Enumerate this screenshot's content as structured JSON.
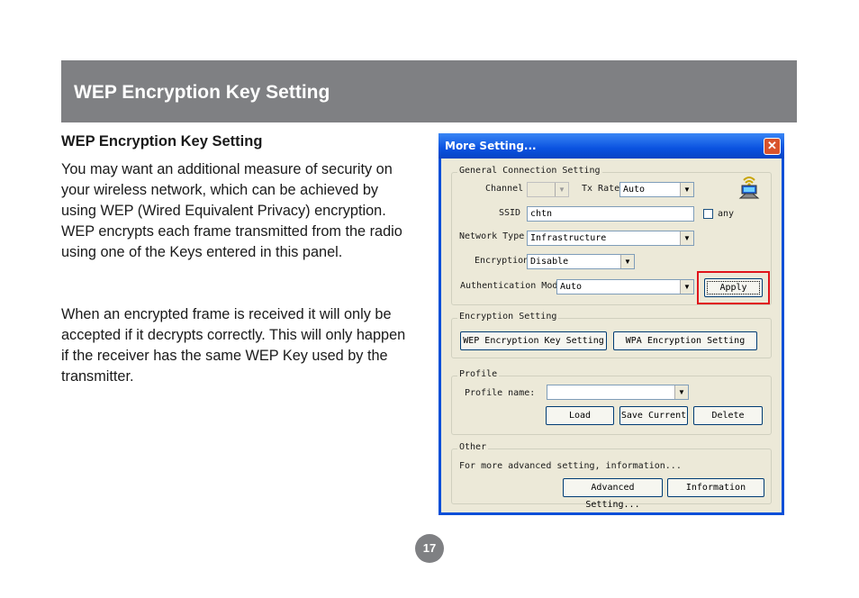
{
  "banner": {
    "title": "WEP Encryption Key Setting"
  },
  "section": {
    "title": "WEP Encryption Key Setting",
    "paragraph1": "You may want an additional measure of security on your wireless network, which can be achieved by using WEP (Wired Equivalent Privacy) encryption. WEP encrypts each frame transmitted from the radio using one of the Keys entered in this panel.",
    "paragraph2": "When an encrypted frame is received it will only be accepted if it decrypts correctly. This will only happen if the receiver has the same WEP Key used by the transmitter."
  },
  "page_number": "17",
  "dialog": {
    "title": "More Setting...",
    "close_icon": "close-icon",
    "general": {
      "label": "General Connection Setting",
      "channel_label": "Channel",
      "channel_value": "",
      "txrate_label": "Tx Rate",
      "txrate_value": "Auto",
      "ssid_label": "SSID",
      "ssid_value": "chtn",
      "any_label": "any",
      "network_type_label": "Network Type",
      "network_type_value": "Infrastructure",
      "encryption_label": "Encryption",
      "encryption_value": "Disable",
      "auth_label": "Authentication Mode",
      "auth_value": "Auto",
      "apply_label": "Apply",
      "icon": "wireless-status-icon"
    },
    "encryption": {
      "label": "Encryption Setting",
      "wep_button": "WEP Encryption Key Setting",
      "wpa_button": "WPA Encryption Setting"
    },
    "profile": {
      "label": "Profile",
      "name_label": "Profile name:",
      "name_value": "",
      "load_button": "Load",
      "save_button": "Save Current",
      "delete_button": "Delete"
    },
    "other": {
      "label": "Other",
      "description": "For more advanced setting, information...",
      "advanced_button": "Advanced Setting...",
      "information_button": "Information"
    },
    "highlight_color": "#e0141b"
  }
}
